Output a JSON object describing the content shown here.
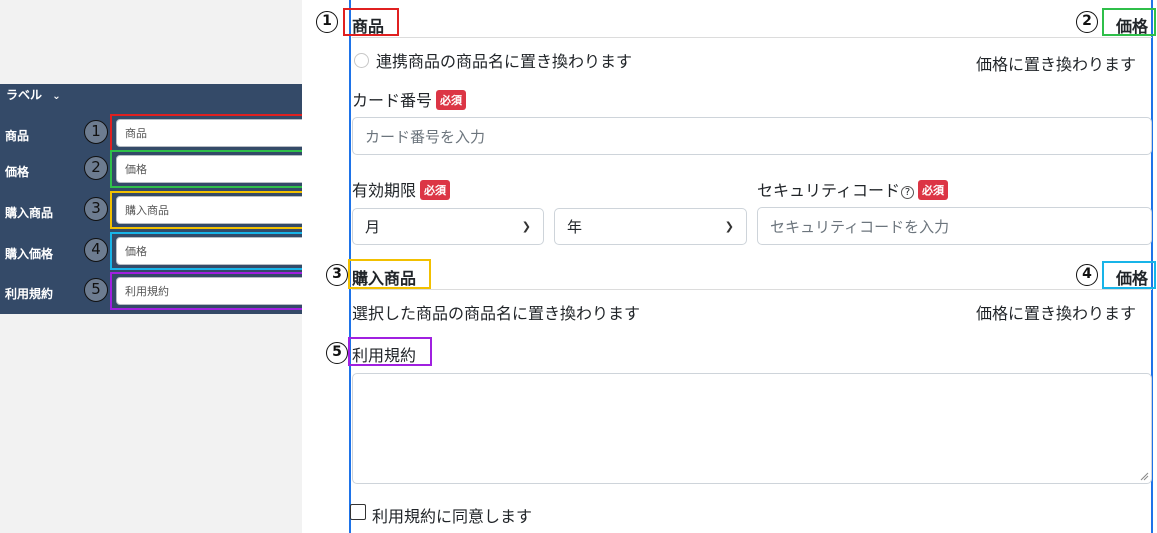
{
  "panel": {
    "header": "ラベル",
    "rows": [
      {
        "label": "商品",
        "num": "1",
        "value": "商品",
        "color": "#e02020"
      },
      {
        "label": "価格",
        "num": "2",
        "value": "価格",
        "color": "#2fbf4a"
      },
      {
        "label": "購入商品",
        "num": "3",
        "value": "購入商品",
        "color": "#f2c000"
      },
      {
        "label": "購入価格",
        "num": "4",
        "value": "価格",
        "color": "#18b4e8"
      },
      {
        "label": "利用規約",
        "num": "5",
        "value": "利用規約",
        "color": "#a020e0"
      }
    ]
  },
  "form": {
    "product_heading": "商品",
    "price_heading": "価格",
    "product_desc": "連携商品の商品名に置き換わります",
    "price_desc": "価格に置き換わります",
    "card_label": "カード番号",
    "required": "必須",
    "card_placeholder": "カード番号を入力",
    "expiry_label": "有効期限",
    "security_label": "セキュリティコード",
    "help_icon": "?",
    "month_value": "月",
    "year_value": "年",
    "security_placeholder": "セキュリティコードを入力",
    "purchase_heading": "購入商品",
    "purchase_price_heading": "価格",
    "purchase_desc": "選択した商品の商品名に置き換わります",
    "purchase_price_desc": "価格に置き換わります",
    "terms_label": "利用規約",
    "agree_label": "利用規約に同意します"
  },
  "markers": {
    "m1": "1",
    "m2": "2",
    "m3": "3",
    "m4": "4",
    "m5": "5"
  },
  "colors": {
    "accent_line": "#1e73e8",
    "required_badge": "#dc3545",
    "panel_bg": "#344a68"
  }
}
